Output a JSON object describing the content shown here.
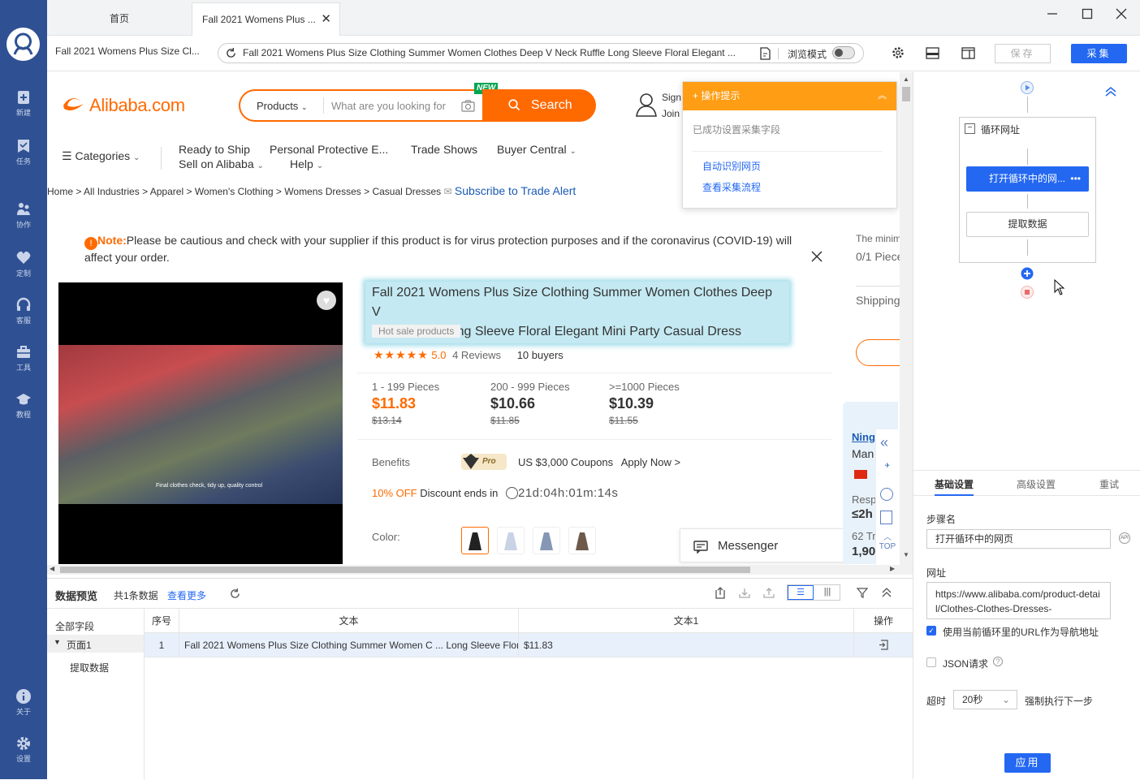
{
  "sidebar": {
    "items": [
      {
        "label": "新建",
        "icon": "plus-doc-icon"
      },
      {
        "label": "任务",
        "icon": "bookmark-icon"
      },
      {
        "label": "协作",
        "icon": "people-icon"
      },
      {
        "label": "定制",
        "icon": "heart-icon"
      },
      {
        "label": "客服",
        "icon": "headset-icon"
      },
      {
        "label": "工具",
        "icon": "toolbox-icon"
      },
      {
        "label": "教程",
        "icon": "graduation-cap-icon"
      }
    ],
    "bottom": [
      {
        "label": "关于",
        "icon": "info-icon"
      },
      {
        "label": "设置",
        "icon": "gear-icon"
      }
    ]
  },
  "tabs": {
    "home": "首页",
    "active": "Fall 2021 Womens Plus ...",
    "close": "✕"
  },
  "address": {
    "page_title": "Fall 2021 Womens Plus Size Cl...",
    "url": "Fall 2021 Womens Plus Size Clothing Summer Women Clothes Deep V Neck Ruffle Long Sleeve Floral Elegant ...",
    "browse_mode": "浏览模式",
    "save": "保存",
    "collect": "采集"
  },
  "alibaba": {
    "logo": "Alibaba.com",
    "search_scope": "Products",
    "search_placeholder": "What are you looking for",
    "new_badge": "NEW",
    "search_button": "Search",
    "sign_in": "Sign",
    "join": "Join",
    "categories": "Categories",
    "nav": [
      "Ready to Ship",
      "Personal Protective E...",
      "Trade Shows",
      "Buyer Central",
      "Sell on Alibaba",
      "Help"
    ],
    "breadcrumb": [
      "Home",
      "All Industries",
      "Apparel",
      "Women's Clothing",
      "Womens Dresses",
      "Casual Dresses"
    ],
    "subscribe": "Subscribe to Trade Alert",
    "note_label": "Note:",
    "note_text": "Please be cautious and check with your supplier if this product is for virus protection purposes and if the coronavirus (COVID-19) will affect your order.",
    "min_order": "The minim",
    "min_pieces": "0/1 Piece",
    "shipping": "Shipping",
    "product_title_line1": "Fall 2021 Womens Plus Size Clothing Summer Women Clothes Deep V",
    "product_title_line2": "Neck Ruffle Long Sleeve Floral Elegant Mini Party Casual Dress",
    "hot_sale": "Hot sale products",
    "rating": "5.0",
    "reviews": "4 Reviews",
    "buyers": "10 buyers",
    "prices": [
      {
        "range": "1 - 199 Pieces",
        "price": "$11.83",
        "old": "$13.14"
      },
      {
        "range": "200 - 999 Pieces",
        "price": "$10.66",
        "old": "$11.85"
      },
      {
        "range": ">=1000 Pieces",
        "price": "$10.39",
        "old": "$11.55"
      }
    ],
    "benefits": "Benefits",
    "pro": "Pro",
    "coupons": "US $3,000 Coupons",
    "apply_now": "Apply Now >",
    "discount": "10% OFF",
    "discount_text": "Discount ends in",
    "countdown": "21d:04h:01m:14s",
    "color_label": "Color:",
    "messenger": "Messenger",
    "video_caption": "Final clothes check, tidy up, quality control",
    "supplier_name": "Ning",
    "supplier_type": "Man",
    "resp": "Resp",
    "resp_time": "≤2h",
    "trans": "62 Tr",
    "trans_amount": "1,90",
    "top": "TOP"
  },
  "hint_popup": {
    "title": "操作提示",
    "message": "已成功设置采集字段",
    "link1": "自动识别网页",
    "link2": "查看采集流程"
  },
  "data_preview": {
    "title": "数据预览",
    "count": "共1条数据",
    "more": "查看更多",
    "all_fields": "全部字段",
    "page1": "页面1",
    "extract": "提取数据",
    "columns": [
      "序号",
      "文本",
      "文本1",
      "操作"
    ],
    "rows": [
      {
        "index": "1",
        "text": "Fall 2021 Womens Plus Size Clothing Summer Women C ... Long Sleeve Flor...",
        "text1": "$11.83"
      }
    ]
  },
  "workflow": {
    "loop": "循环网址",
    "open_page": "打开循环中的网...",
    "extract": "提取数据"
  },
  "settings": {
    "tabs": [
      "基础设置",
      "高级设置",
      "重试"
    ],
    "step_name_label": "步骤名",
    "step_name_value": "打开循环中的网页",
    "url_label": "网址",
    "url_value": "https://www.alibaba.com/product-detail/Clothes-Clothes-Dresses-",
    "use_loop_url": "使用当前循环里的URL作为导航地址",
    "json_request": "JSON请求",
    "timeout_label": "超时",
    "timeout_value": "20秒",
    "force_next": "强制执行下一步",
    "apply": "应用"
  }
}
